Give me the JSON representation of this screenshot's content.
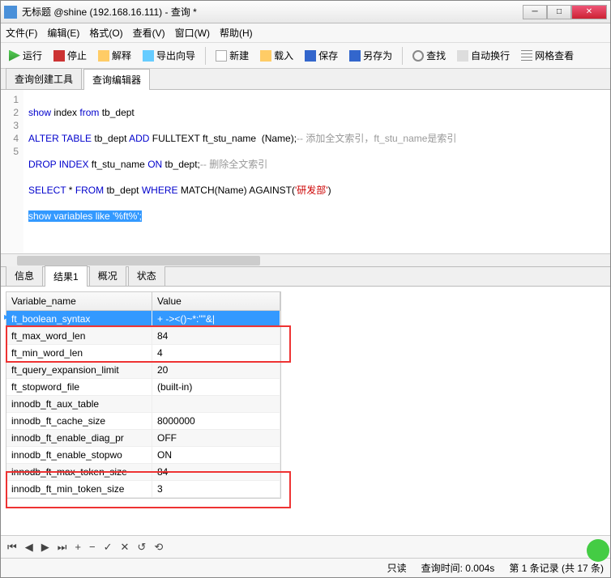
{
  "title": "无标题 @shine (192.168.16.111) - 查询 *",
  "menu": {
    "file": "文件(F)",
    "edit": "编辑(E)",
    "format": "格式(O)",
    "view": "查看(V)",
    "window": "窗口(W)",
    "help": "帮助(H)"
  },
  "toolbar": {
    "run": "运行",
    "stop": "停止",
    "explain": "解释",
    "export": "导出向导",
    "new": "新建",
    "load": "载入",
    "save": "保存",
    "saveas": "另存为",
    "find": "查找",
    "wrap": "自动换行",
    "gridview": "网格查看"
  },
  "tabs_top": {
    "builder": "查询创建工具",
    "editor": "查询编辑器"
  },
  "code": {
    "lines": [
      "1",
      "2",
      "3",
      "4",
      "5"
    ],
    "l1_a": "show",
    "l1_b": " index ",
    "l1_c": "from",
    "l1_d": " tb_dept",
    "l2_a": "ALTER TABLE",
    "l2_b": " tb_dept ",
    "l2_c": "ADD",
    "l2_d": " FULLTEXT ft_stu_name  (Name);",
    "l2_e": "-- 添加全文索引，ft_stu_name是索引",
    "l3_a": "DROP INDEX",
    "l3_b": " ft_stu_name ",
    "l3_c": "ON",
    "l3_d": " tb_dept;",
    "l3_e": "-- 删除全文索引",
    "l4_a": "SELECT",
    "l4_b": " * ",
    "l4_c": "FROM",
    "l4_d": " tb_dept ",
    "l4_e": "WHERE",
    "l4_f": " MATCH(Name) AGAINST(",
    "l4_g": "'研发部'",
    "l4_h": ")",
    "l5": "show variables like '%ft%';"
  },
  "result_tabs": {
    "info": "信息",
    "result1": "结果1",
    "profile": "概况",
    "status": "状态"
  },
  "grid": {
    "headers": {
      "c1": "Variable_name",
      "c2": "Value"
    },
    "rows": [
      {
        "c1": "ft_boolean_syntax",
        "c2": "+ -><()~*:\"\"&|"
      },
      {
        "c1": "ft_max_word_len",
        "c2": "84"
      },
      {
        "c1": "ft_min_word_len",
        "c2": "4"
      },
      {
        "c1": "ft_query_expansion_limit",
        "c2": "20"
      },
      {
        "c1": "ft_stopword_file",
        "c2": "(built-in)"
      },
      {
        "c1": "innodb_ft_aux_table",
        "c2": ""
      },
      {
        "c1": "innodb_ft_cache_size",
        "c2": "8000000"
      },
      {
        "c1": "innodb_ft_enable_diag_pr",
        "c2": "OFF"
      },
      {
        "c1": "innodb_ft_enable_stopwo",
        "c2": "ON"
      },
      {
        "c1": "innodb_ft_max_token_size",
        "c2": "84"
      },
      {
        "c1": "innodb_ft_min_token_size",
        "c2": "3"
      }
    ]
  },
  "status": {
    "readonly": "只读",
    "time_label": "查询时间:",
    "time": "0.004s",
    "record": "第 1 条记录 (共 17 条)"
  }
}
